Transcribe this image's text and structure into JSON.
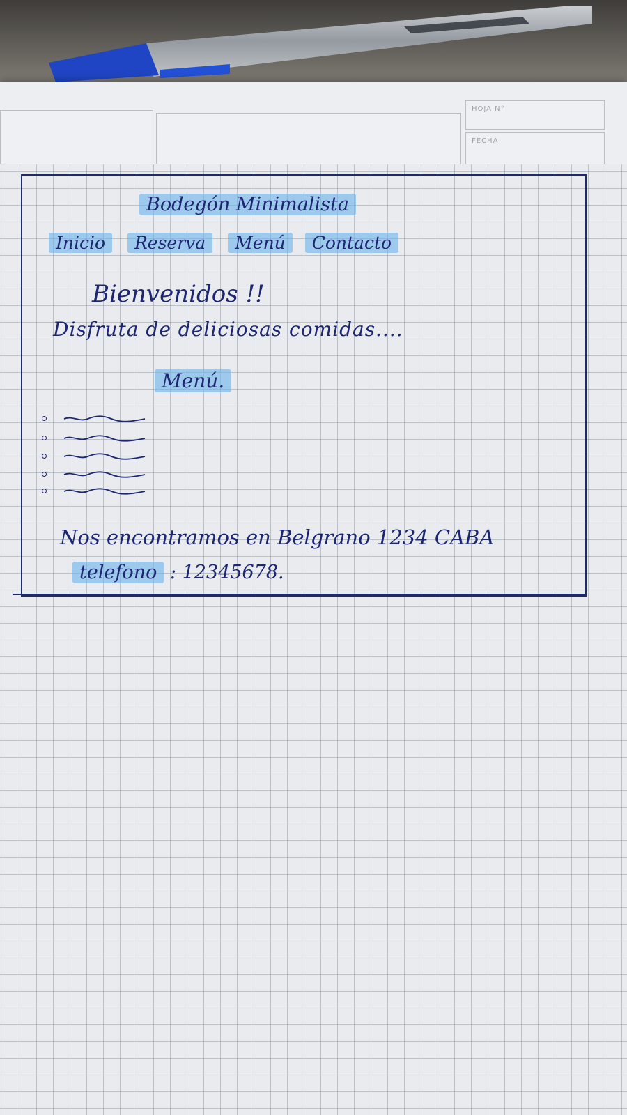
{
  "paper": {
    "hoja_label": "HOJA N°",
    "fecha_label": "FECHA"
  },
  "sketch": {
    "restaurant_name": "Bodegón Minimalista",
    "nav": [
      "Inicio",
      "Reserva",
      "Menú",
      "Contacto"
    ],
    "welcome": "Bienvenidos !!",
    "tagline": "Disfruta de deliciosas comidas....",
    "menu_heading": "Menú.",
    "address": "Nos encontramos en Belgrano 1234 CABA",
    "phone_label": "telefono",
    "phone_value": ": 12345678."
  },
  "colors": {
    "ink": "#1d2670",
    "highlighter": "#6eb4eb",
    "grid": "#969ba5"
  }
}
